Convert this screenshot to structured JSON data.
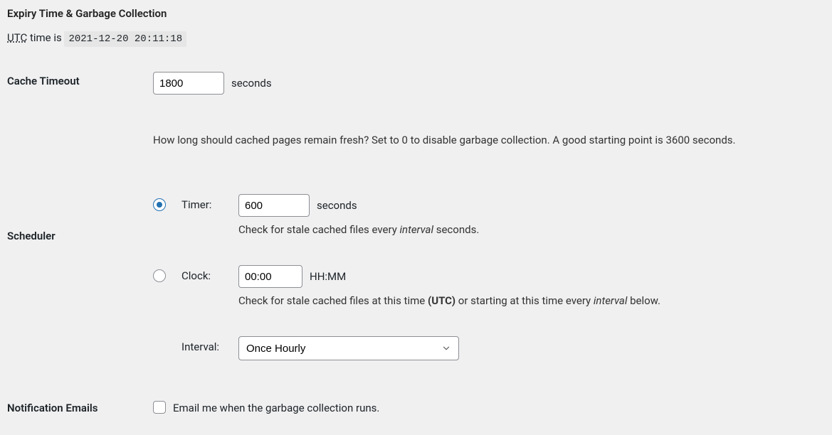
{
  "section": {
    "title": "Expiry Time & Garbage Collection",
    "utc_prefix": "UTC",
    "utc_middle": " time is ",
    "utc_value": "2021-12-20 20:11:18"
  },
  "cache_timeout": {
    "label": "Cache Timeout",
    "value": "1800",
    "unit": "seconds",
    "help": "How long should cached pages remain fresh? Set to 0 to disable garbage collection. A good starting point is 3600 seconds."
  },
  "scheduler": {
    "label": "Scheduler",
    "timer": {
      "name": "Timer:",
      "value": "600",
      "unit": "seconds",
      "desc_a": "Check for stale cached files every ",
      "desc_em": "interval",
      "desc_b": " seconds."
    },
    "clock": {
      "name": "Clock:",
      "value": "00:00",
      "unit": "HH:MM",
      "desc_a": "Check for stale cached files at this time ",
      "desc_bold": "(UTC)",
      "desc_b": " or starting at this time every ",
      "desc_em": "interval",
      "desc_c": " below."
    },
    "interval": {
      "name": "Interval:",
      "selected": "Once Hourly"
    }
  },
  "notification": {
    "label": "Notification Emails",
    "checkbox_label": "Email me when the garbage collection runs."
  }
}
